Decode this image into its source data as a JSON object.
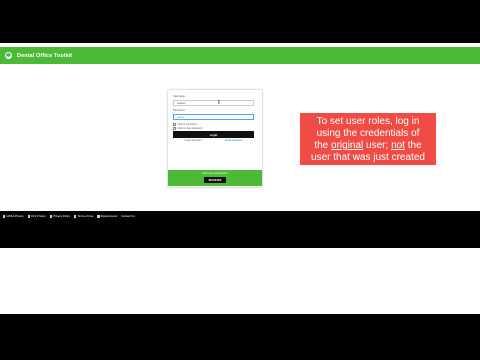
{
  "app": {
    "title": "Dental Office Toolkit"
  },
  "login": {
    "username_label": "Username",
    "username_value": "testuser",
    "password_label": "Password",
    "password_value": "••••••••",
    "remember_label": "Click to remember",
    "show_password_label": "Click to show password",
    "login_button": "Login",
    "forgot_link": "Forgot password",
    "help_link": "Forgot username"
  },
  "register": {
    "prompt": "Don't have an account?",
    "button": "REGISTER"
  },
  "footer": {
    "links": [
      "HIPAA Privacy",
      "DLS Privacy",
      "Privacy Policy",
      "Terms of Use",
      "Requirements",
      "Contact Us"
    ]
  },
  "callout": {
    "line1": "To set user roles, log in",
    "line2": "using the credentials of",
    "line3_pre": "the ",
    "line3_original": "original",
    "line3_mid": " user; ",
    "line3_not": "not",
    "line3_post": " the",
    "line4": "user that was just created"
  },
  "colors": {
    "brand_green": "#4cba36",
    "callout_red": "#f04c45"
  }
}
